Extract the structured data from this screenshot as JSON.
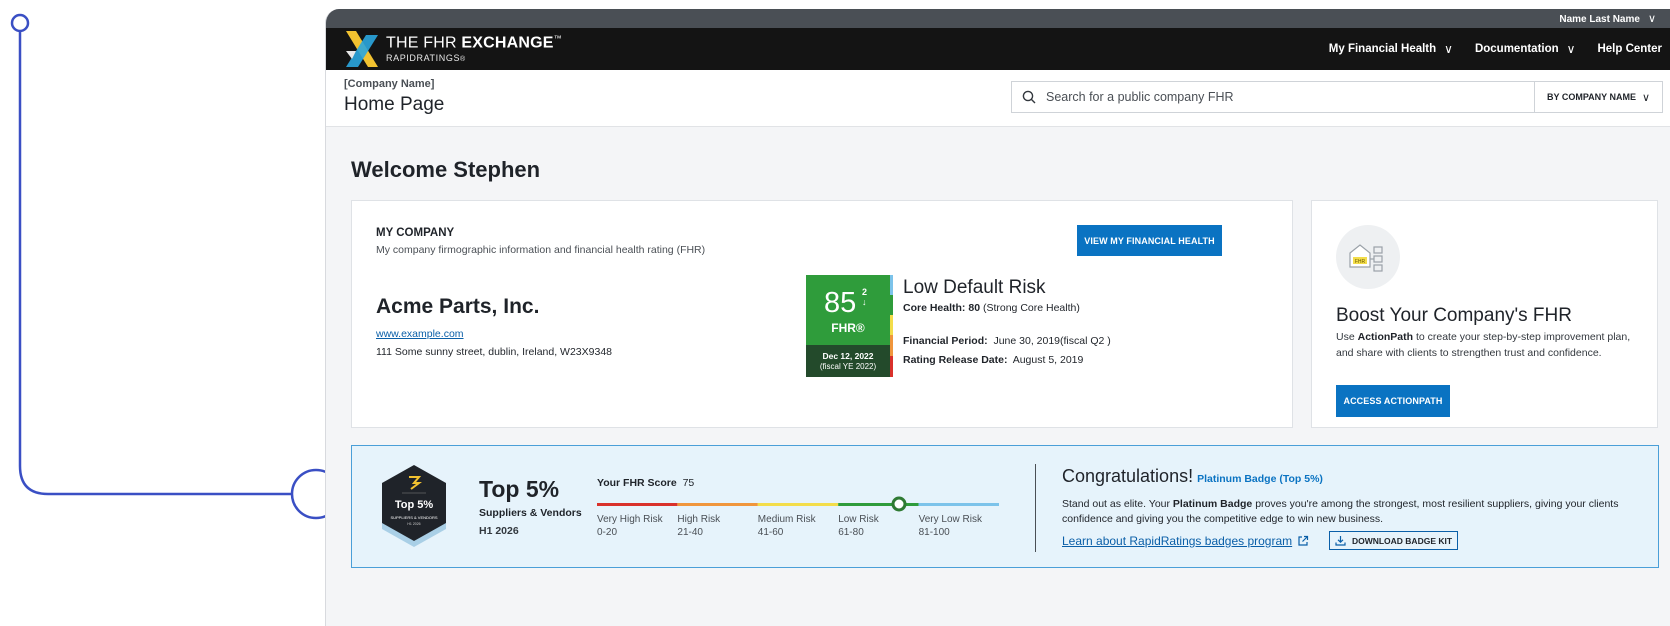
{
  "utility": {
    "user_name": "Name Last Name"
  },
  "nav": {
    "logo_line1_prefix": "THE FHR",
    "logo_line1_bold": "EXCHANGE",
    "logo_tm": "™",
    "logo_line2": "RAPIDRATINGS",
    "logo_reg": "®",
    "items": [
      {
        "label": "My Financial Health",
        "has_dropdown": true
      },
      {
        "label": "Documentation",
        "has_dropdown": true
      },
      {
        "label": "Help Center",
        "has_dropdown": false
      }
    ]
  },
  "header": {
    "breadcrumb": "[Company Name]",
    "title": "Home Page",
    "search_placeholder": "Search for a public company FHR",
    "search_by": "BY COMPANY NAME"
  },
  "welcome": "Welcome Stephen",
  "my_company": {
    "title": "MY COMPANY",
    "subtitle": "My company firmographic information and financial health rating (FHR)",
    "button": "VIEW MY FINANCIAL HEALTH",
    "name": "Acme Parts, Inc.",
    "url": "www.example.com",
    "address": "111 Some sunny street, dublin, Ireland, W23X9348",
    "fhr_score": "85",
    "fhr_change": "2",
    "fhr_change_arrow": "↓",
    "fhr_label": "FHR®",
    "fhr_date": "Dec 12, 2022",
    "fhr_fiscal": "(fiscal YE 2022)",
    "risk_title": "Low Default Risk",
    "core_health_label": "Core Health:",
    "core_health_value": "80",
    "core_health_desc": "(Strong Core Health)",
    "fin_period_label": "Financial Period:",
    "fin_period_value": "June 30, 2019(fiscal Q2 )",
    "release_label": "Rating Release Date:",
    "release_value": "August 5, 2019",
    "colors": {
      "fhr_green": "#2f9c3b",
      "fhr_dark": "#234a2b"
    }
  },
  "boost": {
    "icon_label": "FHR",
    "title": "Boost Your Company's FHR",
    "text_pre": "Use",
    "text_bold": "ActionPath",
    "text_post": "to create your step-by-step improvement plan, and share with clients to strengthen trust and confidence.",
    "button": "ACCESS ACTIONPATH"
  },
  "badge": {
    "hex_title": "Top 5%",
    "hex_sub": "SUPPLIERS & VENDORS",
    "hex_period": "H1 2026",
    "headline": "Top 5%",
    "category": "Suppliers & Vendors",
    "period": "H1 2026",
    "score_label": "Your FHR Score",
    "score_value": "75",
    "score_fraction": 0.75,
    "scale": [
      {
        "name": "Very High Risk",
        "range": "0-20",
        "color": "#d9312b"
      },
      {
        "name": "High Risk",
        "range": "21-40",
        "color": "#f0963c"
      },
      {
        "name": "Medium Risk",
        "range": "41-60",
        "color": "#f3dd4a"
      },
      {
        "name": "Low Risk",
        "range": "61-80",
        "color": "#2f9c3b"
      },
      {
        "name": "Very Low Risk",
        "range": "81-100",
        "color": "#7cc3ea"
      }
    ],
    "congrats_title": "Congratulations!",
    "congrats_tag": "Platinum Badge (Top 5%)",
    "congrats_pre": "Stand out as elite. Your",
    "congrats_bold": "Platinum Badge",
    "congrats_post": "proves you're among the strongest, most resilient suppliers, giving your clients confidence and giving you the competitive edge to win new business.",
    "learn_link": "Learn about RapidRatings badges program",
    "download_button": "DOWNLOAD BADGE KIT"
  },
  "colors": {
    "primary": "#0a73c2",
    "annotation": "#3a4fc4",
    "badge_bg": "#e6f3fb"
  }
}
